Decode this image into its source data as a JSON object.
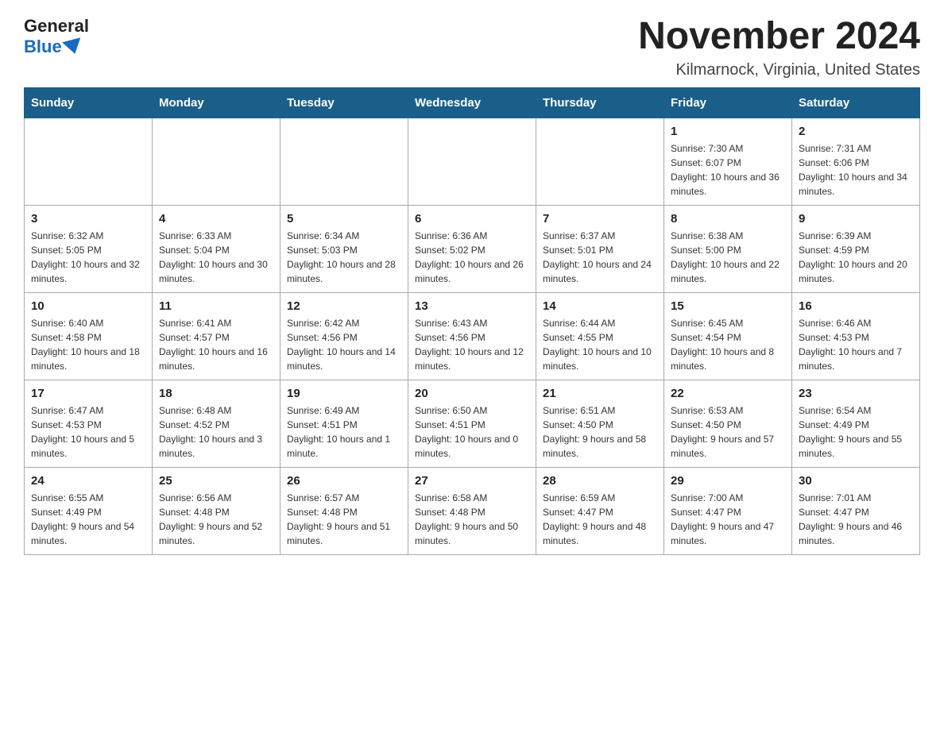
{
  "logo": {
    "general": "General",
    "blue": "Blue"
  },
  "title": "November 2024",
  "location": "Kilmarnock, Virginia, United States",
  "weekdays": [
    "Sunday",
    "Monday",
    "Tuesday",
    "Wednesday",
    "Thursday",
    "Friday",
    "Saturday"
  ],
  "weeks": [
    [
      {
        "day": "",
        "sunrise": "",
        "sunset": "",
        "daylight": ""
      },
      {
        "day": "",
        "sunrise": "",
        "sunset": "",
        "daylight": ""
      },
      {
        "day": "",
        "sunrise": "",
        "sunset": "",
        "daylight": ""
      },
      {
        "day": "",
        "sunrise": "",
        "sunset": "",
        "daylight": ""
      },
      {
        "day": "",
        "sunrise": "",
        "sunset": "",
        "daylight": ""
      },
      {
        "day": "1",
        "sunrise": "Sunrise: 7:30 AM",
        "sunset": "Sunset: 6:07 PM",
        "daylight": "Daylight: 10 hours and 36 minutes."
      },
      {
        "day": "2",
        "sunrise": "Sunrise: 7:31 AM",
        "sunset": "Sunset: 6:06 PM",
        "daylight": "Daylight: 10 hours and 34 minutes."
      }
    ],
    [
      {
        "day": "3",
        "sunrise": "Sunrise: 6:32 AM",
        "sunset": "Sunset: 5:05 PM",
        "daylight": "Daylight: 10 hours and 32 minutes."
      },
      {
        "day": "4",
        "sunrise": "Sunrise: 6:33 AM",
        "sunset": "Sunset: 5:04 PM",
        "daylight": "Daylight: 10 hours and 30 minutes."
      },
      {
        "day": "5",
        "sunrise": "Sunrise: 6:34 AM",
        "sunset": "Sunset: 5:03 PM",
        "daylight": "Daylight: 10 hours and 28 minutes."
      },
      {
        "day": "6",
        "sunrise": "Sunrise: 6:36 AM",
        "sunset": "Sunset: 5:02 PM",
        "daylight": "Daylight: 10 hours and 26 minutes."
      },
      {
        "day": "7",
        "sunrise": "Sunrise: 6:37 AM",
        "sunset": "Sunset: 5:01 PM",
        "daylight": "Daylight: 10 hours and 24 minutes."
      },
      {
        "day": "8",
        "sunrise": "Sunrise: 6:38 AM",
        "sunset": "Sunset: 5:00 PM",
        "daylight": "Daylight: 10 hours and 22 minutes."
      },
      {
        "day": "9",
        "sunrise": "Sunrise: 6:39 AM",
        "sunset": "Sunset: 4:59 PM",
        "daylight": "Daylight: 10 hours and 20 minutes."
      }
    ],
    [
      {
        "day": "10",
        "sunrise": "Sunrise: 6:40 AM",
        "sunset": "Sunset: 4:58 PM",
        "daylight": "Daylight: 10 hours and 18 minutes."
      },
      {
        "day": "11",
        "sunrise": "Sunrise: 6:41 AM",
        "sunset": "Sunset: 4:57 PM",
        "daylight": "Daylight: 10 hours and 16 minutes."
      },
      {
        "day": "12",
        "sunrise": "Sunrise: 6:42 AM",
        "sunset": "Sunset: 4:56 PM",
        "daylight": "Daylight: 10 hours and 14 minutes."
      },
      {
        "day": "13",
        "sunrise": "Sunrise: 6:43 AM",
        "sunset": "Sunset: 4:56 PM",
        "daylight": "Daylight: 10 hours and 12 minutes."
      },
      {
        "day": "14",
        "sunrise": "Sunrise: 6:44 AM",
        "sunset": "Sunset: 4:55 PM",
        "daylight": "Daylight: 10 hours and 10 minutes."
      },
      {
        "day": "15",
        "sunrise": "Sunrise: 6:45 AM",
        "sunset": "Sunset: 4:54 PM",
        "daylight": "Daylight: 10 hours and 8 minutes."
      },
      {
        "day": "16",
        "sunrise": "Sunrise: 6:46 AM",
        "sunset": "Sunset: 4:53 PM",
        "daylight": "Daylight: 10 hours and 7 minutes."
      }
    ],
    [
      {
        "day": "17",
        "sunrise": "Sunrise: 6:47 AM",
        "sunset": "Sunset: 4:53 PM",
        "daylight": "Daylight: 10 hours and 5 minutes."
      },
      {
        "day": "18",
        "sunrise": "Sunrise: 6:48 AM",
        "sunset": "Sunset: 4:52 PM",
        "daylight": "Daylight: 10 hours and 3 minutes."
      },
      {
        "day": "19",
        "sunrise": "Sunrise: 6:49 AM",
        "sunset": "Sunset: 4:51 PM",
        "daylight": "Daylight: 10 hours and 1 minute."
      },
      {
        "day": "20",
        "sunrise": "Sunrise: 6:50 AM",
        "sunset": "Sunset: 4:51 PM",
        "daylight": "Daylight: 10 hours and 0 minutes."
      },
      {
        "day": "21",
        "sunrise": "Sunrise: 6:51 AM",
        "sunset": "Sunset: 4:50 PM",
        "daylight": "Daylight: 9 hours and 58 minutes."
      },
      {
        "day": "22",
        "sunrise": "Sunrise: 6:53 AM",
        "sunset": "Sunset: 4:50 PM",
        "daylight": "Daylight: 9 hours and 57 minutes."
      },
      {
        "day": "23",
        "sunrise": "Sunrise: 6:54 AM",
        "sunset": "Sunset: 4:49 PM",
        "daylight": "Daylight: 9 hours and 55 minutes."
      }
    ],
    [
      {
        "day": "24",
        "sunrise": "Sunrise: 6:55 AM",
        "sunset": "Sunset: 4:49 PM",
        "daylight": "Daylight: 9 hours and 54 minutes."
      },
      {
        "day": "25",
        "sunrise": "Sunrise: 6:56 AM",
        "sunset": "Sunset: 4:48 PM",
        "daylight": "Daylight: 9 hours and 52 minutes."
      },
      {
        "day": "26",
        "sunrise": "Sunrise: 6:57 AM",
        "sunset": "Sunset: 4:48 PM",
        "daylight": "Daylight: 9 hours and 51 minutes."
      },
      {
        "day": "27",
        "sunrise": "Sunrise: 6:58 AM",
        "sunset": "Sunset: 4:48 PM",
        "daylight": "Daylight: 9 hours and 50 minutes."
      },
      {
        "day": "28",
        "sunrise": "Sunrise: 6:59 AM",
        "sunset": "Sunset: 4:47 PM",
        "daylight": "Daylight: 9 hours and 48 minutes."
      },
      {
        "day": "29",
        "sunrise": "Sunrise: 7:00 AM",
        "sunset": "Sunset: 4:47 PM",
        "daylight": "Daylight: 9 hours and 47 minutes."
      },
      {
        "day": "30",
        "sunrise": "Sunrise: 7:01 AM",
        "sunset": "Sunset: 4:47 PM",
        "daylight": "Daylight: 9 hours and 46 minutes."
      }
    ]
  ]
}
